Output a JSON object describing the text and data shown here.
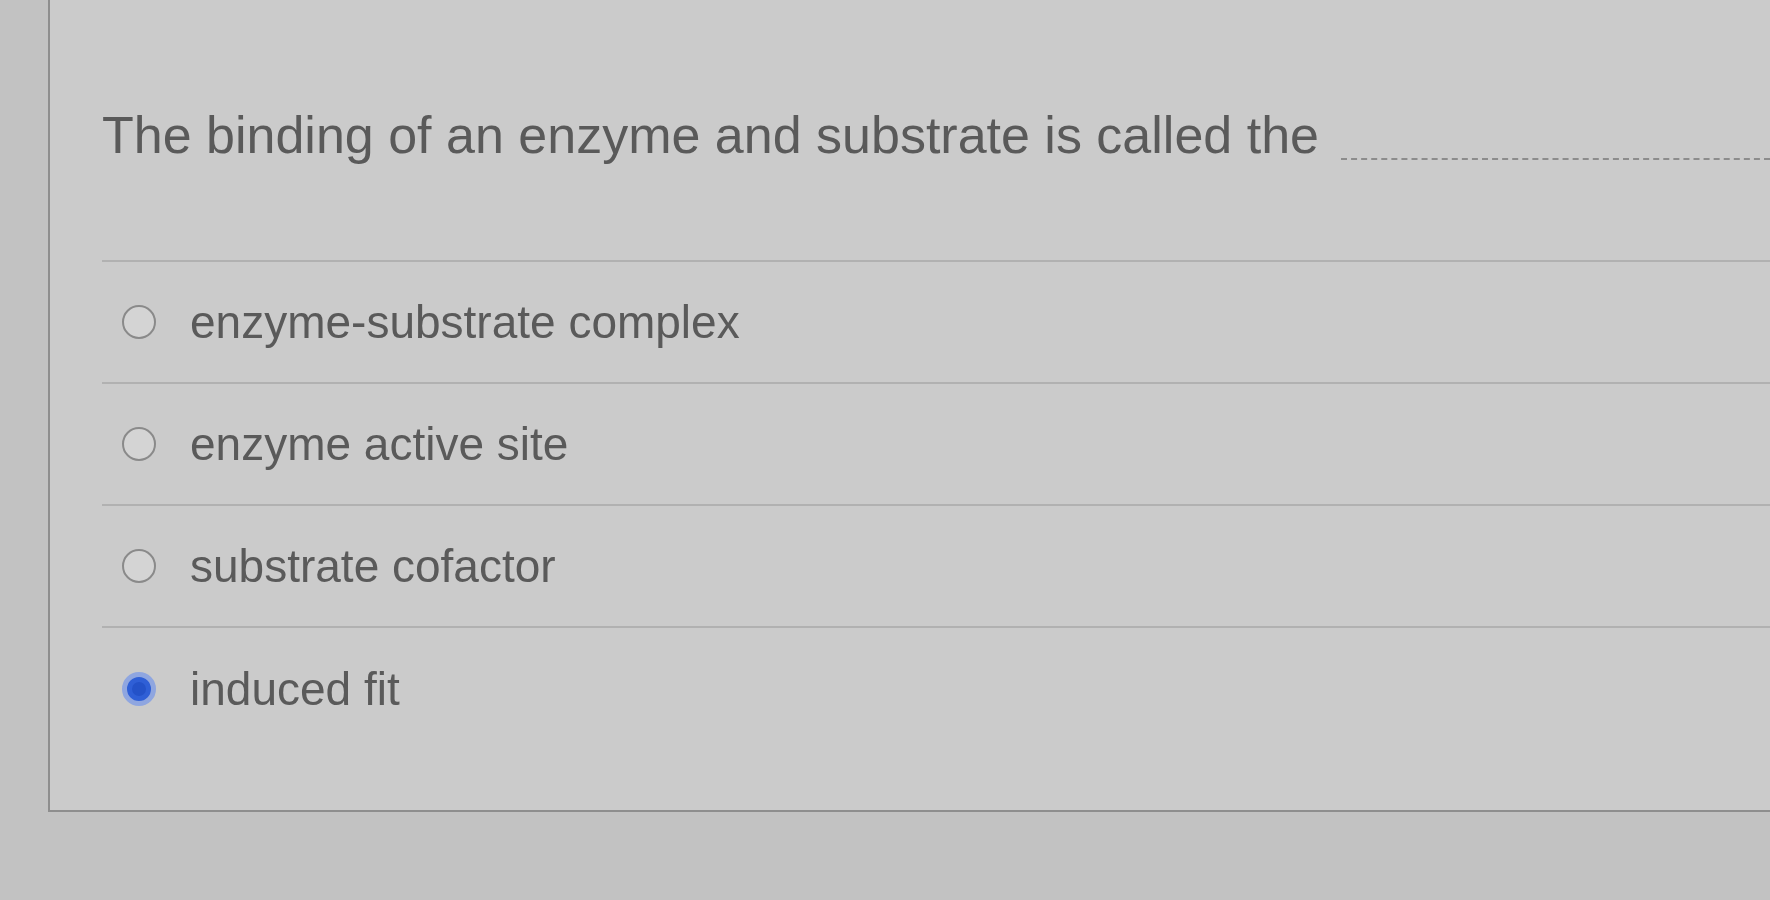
{
  "question": {
    "text": "The binding of an enzyme and substrate is called the"
  },
  "options": [
    {
      "label": "enzyme-substrate complex",
      "selected": false
    },
    {
      "label": "enzyme active site",
      "selected": false
    },
    {
      "label": "substrate cofactor",
      "selected": false
    },
    {
      "label": "induced fit",
      "selected": true
    }
  ]
}
